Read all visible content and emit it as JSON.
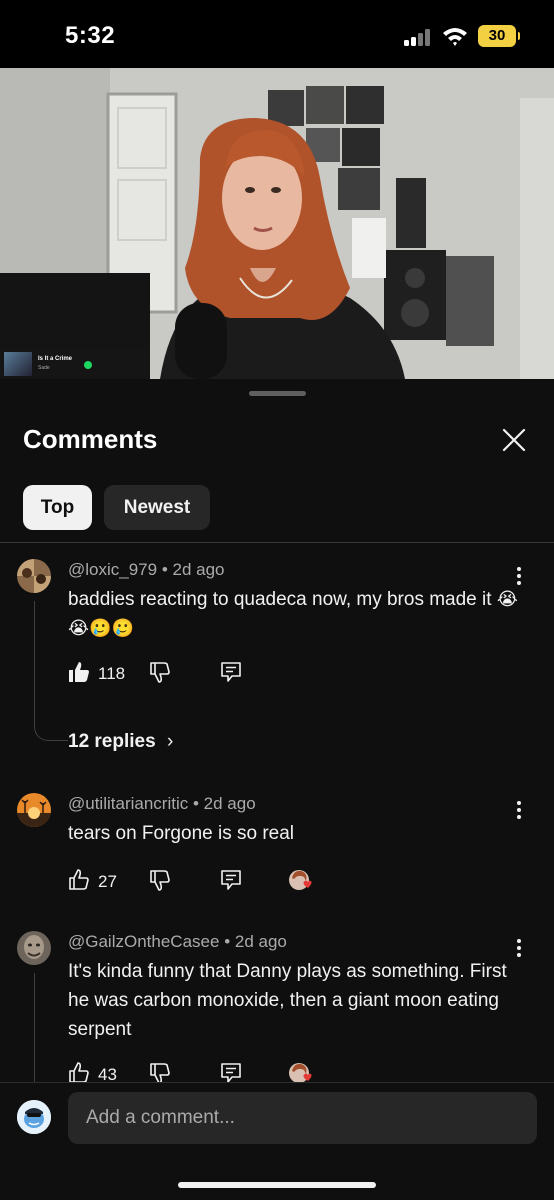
{
  "status_bar": {
    "time": "5:32",
    "battery": "30"
  },
  "video": {
    "now_playing": {
      "title": "Is It a Crime",
      "artist": "Sade"
    }
  },
  "sheet": {
    "title": "Comments",
    "filters": [
      {
        "label": "Top",
        "selected": true
      },
      {
        "label": "Newest",
        "selected": false
      }
    ]
  },
  "comments": [
    {
      "author": "@loxic_979",
      "age": "2d ago",
      "text": "baddies reacting to quadeca now, my bros made it",
      "emojis": "😭😭🥲🥲",
      "likes": "118",
      "replies_label": "12 replies",
      "liked": true
    },
    {
      "author": "@utilitariancritic",
      "age": "2d ago",
      "text": "tears on Forgone is so real",
      "likes": "27",
      "creator_heart": true
    },
    {
      "author": "@GailzOntheCasee",
      "age": "2d ago",
      "text": "It's kinda funny that Danny plays as something. First he was carbon monoxide, then a giant moon eating serpent",
      "likes": "43",
      "creator_heart": true
    }
  ],
  "input": {
    "placeholder": "Add a comment..."
  },
  "colors": {
    "background": "#0f0f0f",
    "chip_selected": "#f1f1f1",
    "chip_unselected": "#272727",
    "secondary_text": "#aaaaaa",
    "heart": "#e53935",
    "battery": "#f3d042"
  }
}
